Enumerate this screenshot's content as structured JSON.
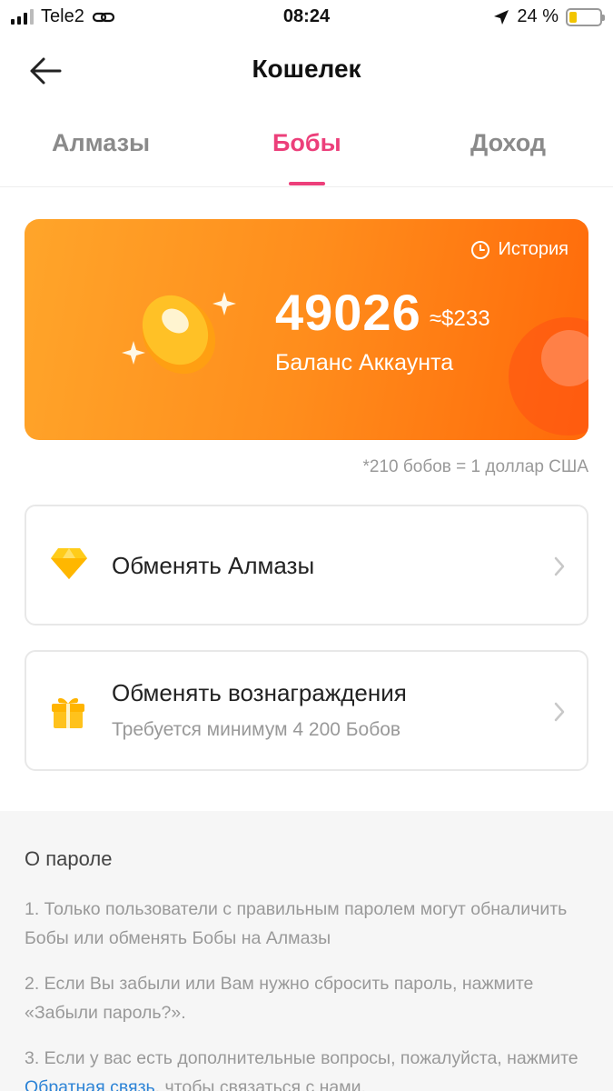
{
  "status_bar": {
    "carrier": "Tele2",
    "time": "08:24",
    "battery_percent": "24 %",
    "battery_level": 0.24
  },
  "header": {
    "title": "Кошелек"
  },
  "tabs": [
    {
      "label": "Алмазы",
      "active": false
    },
    {
      "label": "Бобы",
      "active": true
    },
    {
      "label": "Доход",
      "active": false
    }
  ],
  "balance": {
    "history_label": "История",
    "amount": "49026",
    "usd": "≈$233",
    "label": "Баланс Аккаунта"
  },
  "rate_note": "*210 бобов = 1 доллар США",
  "actions": {
    "exchange_diamonds": {
      "title": "Обменять Алмазы"
    },
    "exchange_rewards": {
      "title": "Обменять вознаграждения",
      "subtitle": "Требуется минимум 4 200 Бобов"
    }
  },
  "info": {
    "title": "О пароле",
    "p1": "1. Только пользователи с правильным паролем могут обналичить Бобы или обменять Бобы на Алмазы",
    "p2": "2. Если Вы забыли или Вам нужно сбросить пароль, нажмите «Забыли пароль?».",
    "p3_before": "3. Если у вас есть дополнительные вопросы, пожалуйста, нажмите ",
    "p3_link": "Обратная связь",
    "p3_after": ", чтобы связаться с нами."
  },
  "colors": {
    "accent": "#ec3f7a",
    "card_gradient_start": "#ffa52a",
    "card_gradient_end": "#ff6a0a",
    "link": "#2c83d6"
  },
  "icons": {
    "back": "arrow-left-icon",
    "history": "clock-icon",
    "coin": "coin-icon",
    "diamond": "diamond-icon",
    "gift": "gift-icon",
    "chevron": "chevron-right-icon"
  }
}
